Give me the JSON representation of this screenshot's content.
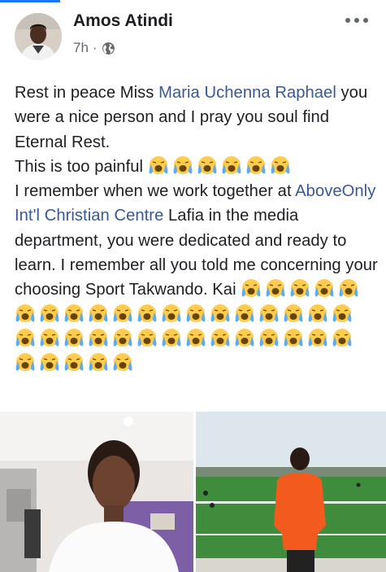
{
  "post": {
    "author": "Amos Atindi",
    "time": "7h",
    "separator": "·",
    "privacy_icon": "globe-icon",
    "more_icon": "more-options-icon"
  },
  "content": {
    "p1_a": "Rest in peace Miss ",
    "p1_link": "Maria Uchenna Raphael",
    "p1_b": " you were a nice person and I pray you soul find Eternal Rest.",
    "p2": "This is too painful",
    "p3_a": "I remember when we work together at ",
    "p3_link": "AboveOnly Int'l Christian Centre",
    "p3_b": " Lafia in the media department, you were dedicated and ready to learn. I remember all you told me concerning your choosing Sport Takwando. Kai",
    "emoji_name": "loudly-crying-face-emoji",
    "emoji_counts": {
      "after_painful": 6,
      "after_kai": 38
    }
  },
  "colors": {
    "link": "#385898",
    "text": "#1c1e21",
    "meta": "#65676b",
    "accent": "#1877f2",
    "emoji_face": "#ffcc4d",
    "emoji_tear": "#5dadec"
  },
  "photos": [
    {
      "name": "photo-selfie",
      "description_icon": "photo"
    },
    {
      "name": "photo-football-field",
      "description_icon": "photo"
    }
  ]
}
